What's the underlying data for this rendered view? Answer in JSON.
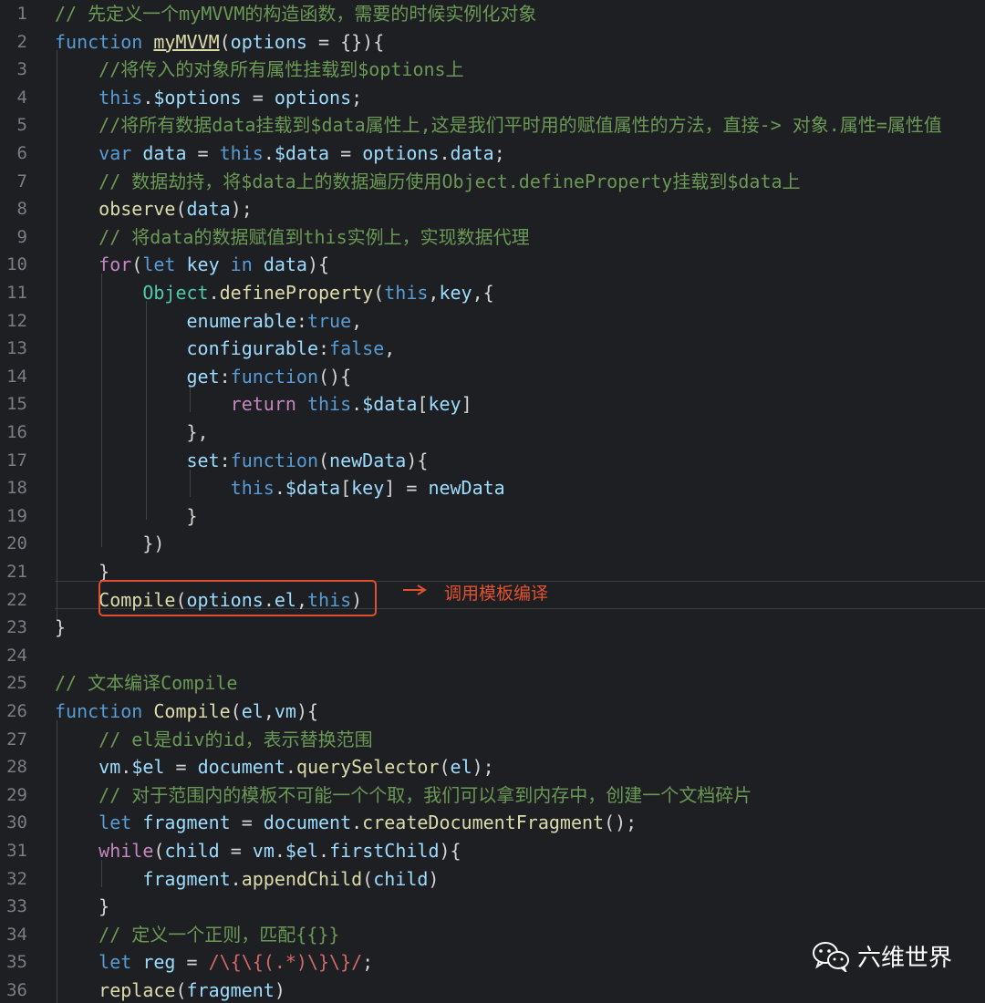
{
  "editor": {
    "lines": [
      {
        "num": "1",
        "tokens": [
          {
            "t": "// 先定义一个myMVVM的构造函数，需要的时候实例化对象",
            "c": "comment"
          }
        ]
      },
      {
        "num": "2",
        "tokens": [
          {
            "t": "function ",
            "c": "kw"
          },
          {
            "t": "myMVVM",
            "c": "fnname"
          },
          {
            "t": "(",
            "c": "plain"
          },
          {
            "t": "options",
            "c": "var"
          },
          {
            "t": " = {}){",
            "c": "plain"
          }
        ]
      },
      {
        "num": "3",
        "tokens": [
          {
            "t": "    //将传入的对象所有属性挂载到$options上",
            "c": "comment"
          }
        ]
      },
      {
        "num": "4",
        "tokens": [
          {
            "t": "    ",
            "c": "plain"
          },
          {
            "t": "this",
            "c": "kw"
          },
          {
            "t": ".",
            "c": "plain"
          },
          {
            "t": "$options",
            "c": "var"
          },
          {
            "t": " = ",
            "c": "plain"
          },
          {
            "t": "options",
            "c": "var"
          },
          {
            "t": ";",
            "c": "plain"
          }
        ]
      },
      {
        "num": "5",
        "tokens": [
          {
            "t": "    //将所有数据data挂载到$data属性上,这是我们平时用的赋值属性的方法，直接-> 对象.属性=属性值",
            "c": "comment"
          }
        ]
      },
      {
        "num": "6",
        "tokens": [
          {
            "t": "    ",
            "c": "plain"
          },
          {
            "t": "var ",
            "c": "kw"
          },
          {
            "t": "data",
            "c": "var"
          },
          {
            "t": " = ",
            "c": "plain"
          },
          {
            "t": "this",
            "c": "kw"
          },
          {
            "t": ".",
            "c": "plain"
          },
          {
            "t": "$data",
            "c": "var"
          },
          {
            "t": " = ",
            "c": "plain"
          },
          {
            "t": "options",
            "c": "var"
          },
          {
            "t": ".",
            "c": "plain"
          },
          {
            "t": "data",
            "c": "var"
          },
          {
            "t": ";",
            "c": "plain"
          }
        ]
      },
      {
        "num": "7",
        "tokens": [
          {
            "t": "    // 数据劫持，将$data上的数据遍历使用Object.defineProperty挂载到$data上",
            "c": "comment"
          }
        ]
      },
      {
        "num": "8",
        "tokens": [
          {
            "t": "    ",
            "c": "plain"
          },
          {
            "t": "observe",
            "c": "fn"
          },
          {
            "t": "(",
            "c": "plain"
          },
          {
            "t": "data",
            "c": "var"
          },
          {
            "t": ");",
            "c": "plain"
          }
        ]
      },
      {
        "num": "9",
        "tokens": [
          {
            "t": "    // 将data的数据赋值到this实例上，实现数据代理",
            "c": "comment"
          }
        ]
      },
      {
        "num": "10",
        "tokens": [
          {
            "t": "    ",
            "c": "plain"
          },
          {
            "t": "for",
            "c": "ctrl"
          },
          {
            "t": "(",
            "c": "plain"
          },
          {
            "t": "let ",
            "c": "kw"
          },
          {
            "t": "key",
            "c": "var"
          },
          {
            "t": " in ",
            "c": "kw"
          },
          {
            "t": "data",
            "c": "var"
          },
          {
            "t": "){",
            "c": "plain"
          }
        ]
      },
      {
        "num": "11",
        "tokens": [
          {
            "t": "        ",
            "c": "plain"
          },
          {
            "t": "Object",
            "c": "type"
          },
          {
            "t": ".",
            "c": "plain"
          },
          {
            "t": "defineProperty",
            "c": "fn"
          },
          {
            "t": "(",
            "c": "plain"
          },
          {
            "t": "this",
            "c": "kw"
          },
          {
            "t": ",",
            "c": "plain"
          },
          {
            "t": "key",
            "c": "var"
          },
          {
            "t": ",{",
            "c": "plain"
          }
        ]
      },
      {
        "num": "12",
        "tokens": [
          {
            "t": "            ",
            "c": "plain"
          },
          {
            "t": "enumerable",
            "c": "var"
          },
          {
            "t": ":",
            "c": "plain"
          },
          {
            "t": "true",
            "c": "kw"
          },
          {
            "t": ",",
            "c": "plain"
          }
        ]
      },
      {
        "num": "13",
        "tokens": [
          {
            "t": "            ",
            "c": "plain"
          },
          {
            "t": "configurable",
            "c": "var"
          },
          {
            "t": ":",
            "c": "plain"
          },
          {
            "t": "false",
            "c": "kw"
          },
          {
            "t": ",",
            "c": "plain"
          }
        ]
      },
      {
        "num": "14",
        "tokens": [
          {
            "t": "            ",
            "c": "plain"
          },
          {
            "t": "get",
            "c": "var"
          },
          {
            "t": ":",
            "c": "plain"
          },
          {
            "t": "function",
            "c": "kw"
          },
          {
            "t": "(){",
            "c": "plain"
          }
        ]
      },
      {
        "num": "15",
        "tokens": [
          {
            "t": "                ",
            "c": "plain"
          },
          {
            "t": "return ",
            "c": "ctrl"
          },
          {
            "t": "this",
            "c": "kw"
          },
          {
            "t": ".",
            "c": "plain"
          },
          {
            "t": "$data",
            "c": "var"
          },
          {
            "t": "[",
            "c": "plain"
          },
          {
            "t": "key",
            "c": "var"
          },
          {
            "t": "]",
            "c": "plain"
          }
        ]
      },
      {
        "num": "16",
        "tokens": [
          {
            "t": "            },",
            "c": "plain"
          }
        ]
      },
      {
        "num": "17",
        "tokens": [
          {
            "t": "            ",
            "c": "plain"
          },
          {
            "t": "set",
            "c": "var"
          },
          {
            "t": ":",
            "c": "plain"
          },
          {
            "t": "function",
            "c": "kw"
          },
          {
            "t": "(",
            "c": "plain"
          },
          {
            "t": "newData",
            "c": "var"
          },
          {
            "t": "){",
            "c": "plain"
          }
        ]
      },
      {
        "num": "18",
        "tokens": [
          {
            "t": "                ",
            "c": "plain"
          },
          {
            "t": "this",
            "c": "kw"
          },
          {
            "t": ".",
            "c": "plain"
          },
          {
            "t": "$data",
            "c": "var"
          },
          {
            "t": "[",
            "c": "plain"
          },
          {
            "t": "key",
            "c": "var"
          },
          {
            "t": "] = ",
            "c": "plain"
          },
          {
            "t": "newData",
            "c": "var"
          }
        ]
      },
      {
        "num": "19",
        "tokens": [
          {
            "t": "            }",
            "c": "plain"
          }
        ]
      },
      {
        "num": "20",
        "tokens": [
          {
            "t": "        })",
            "c": "plain"
          }
        ]
      },
      {
        "num": "21",
        "tokens": [
          {
            "t": "    }",
            "c": "plain"
          }
        ]
      },
      {
        "num": "22",
        "tokens": [
          {
            "t": "    ",
            "c": "plain"
          },
          {
            "t": "Compile",
            "c": "fn"
          },
          {
            "t": "(",
            "c": "plain"
          },
          {
            "t": "options",
            "c": "var"
          },
          {
            "t": ".",
            "c": "plain"
          },
          {
            "t": "el",
            "c": "var"
          },
          {
            "t": ",",
            "c": "plain"
          },
          {
            "t": "this",
            "c": "kw"
          },
          {
            "t": ")",
            "c": "plain"
          }
        ]
      },
      {
        "num": "23",
        "tokens": [
          {
            "t": "}",
            "c": "plain"
          }
        ]
      },
      {
        "num": "24",
        "tokens": []
      },
      {
        "num": "25",
        "tokens": [
          {
            "t": "// 文本编译Compile",
            "c": "comment"
          }
        ]
      },
      {
        "num": "26",
        "tokens": [
          {
            "t": "function ",
            "c": "kw"
          },
          {
            "t": "Compile",
            "c": "fn"
          },
          {
            "t": "(",
            "c": "plain"
          },
          {
            "t": "el",
            "c": "var"
          },
          {
            "t": ",",
            "c": "plain"
          },
          {
            "t": "vm",
            "c": "var"
          },
          {
            "t": "){",
            "c": "plain"
          }
        ]
      },
      {
        "num": "27",
        "tokens": [
          {
            "t": "    // el是div的id，表示替换范围",
            "c": "comment"
          }
        ]
      },
      {
        "num": "28",
        "tokens": [
          {
            "t": "    ",
            "c": "plain"
          },
          {
            "t": "vm",
            "c": "var"
          },
          {
            "t": ".",
            "c": "plain"
          },
          {
            "t": "$el",
            "c": "var"
          },
          {
            "t": " = ",
            "c": "plain"
          },
          {
            "t": "document",
            "c": "var"
          },
          {
            "t": ".",
            "c": "plain"
          },
          {
            "t": "querySelector",
            "c": "fn"
          },
          {
            "t": "(",
            "c": "plain"
          },
          {
            "t": "el",
            "c": "var"
          },
          {
            "t": ");",
            "c": "plain"
          }
        ]
      },
      {
        "num": "29",
        "tokens": [
          {
            "t": "    // 对于范围内的模板不可能一个个取，我们可以拿到内存中，创建一个文档碎片",
            "c": "comment"
          }
        ]
      },
      {
        "num": "30",
        "tokens": [
          {
            "t": "    ",
            "c": "plain"
          },
          {
            "t": "let ",
            "c": "kw"
          },
          {
            "t": "fragment",
            "c": "var"
          },
          {
            "t": " = ",
            "c": "plain"
          },
          {
            "t": "document",
            "c": "var"
          },
          {
            "t": ".",
            "c": "plain"
          },
          {
            "t": "createDocumentFragment",
            "c": "fn"
          },
          {
            "t": "();",
            "c": "plain"
          }
        ]
      },
      {
        "num": "31",
        "tokens": [
          {
            "t": "    ",
            "c": "plain"
          },
          {
            "t": "while",
            "c": "ctrl"
          },
          {
            "t": "(",
            "c": "plain"
          },
          {
            "t": "child",
            "c": "var"
          },
          {
            "t": " = ",
            "c": "plain"
          },
          {
            "t": "vm",
            "c": "var"
          },
          {
            "t": ".",
            "c": "plain"
          },
          {
            "t": "$el",
            "c": "var"
          },
          {
            "t": ".",
            "c": "plain"
          },
          {
            "t": "firstChild",
            "c": "var"
          },
          {
            "t": "){",
            "c": "plain"
          }
        ]
      },
      {
        "num": "32",
        "tokens": [
          {
            "t": "        ",
            "c": "plain"
          },
          {
            "t": "fragment",
            "c": "var"
          },
          {
            "t": ".",
            "c": "plain"
          },
          {
            "t": "appendChild",
            "c": "fn"
          },
          {
            "t": "(",
            "c": "plain"
          },
          {
            "t": "child",
            "c": "var"
          },
          {
            "t": ")",
            "c": "plain"
          }
        ]
      },
      {
        "num": "33",
        "tokens": [
          {
            "t": "    }",
            "c": "plain"
          }
        ]
      },
      {
        "num": "34",
        "tokens": [
          {
            "t": "    // 定义一个正则，匹配{{}}",
            "c": "comment"
          }
        ]
      },
      {
        "num": "35",
        "tokens": [
          {
            "t": "    ",
            "c": "plain"
          },
          {
            "t": "let ",
            "c": "kw"
          },
          {
            "t": "reg",
            "c": "var"
          },
          {
            "t": " = ",
            "c": "plain"
          },
          {
            "t": "/\\{\\{(.*)\\}\\}/",
            "c": "regex"
          },
          {
            "t": ";",
            "c": "plain"
          }
        ]
      },
      {
        "num": "36",
        "tokens": [
          {
            "t": "    ",
            "c": "plain"
          },
          {
            "t": "replace",
            "c": "fn"
          },
          {
            "t": "(",
            "c": "plain"
          },
          {
            "t": "fragment",
            "c": "var"
          },
          {
            "t": ")",
            "c": "plain"
          }
        ]
      }
    ],
    "current_line": "22"
  },
  "annotation": {
    "text": "调用模板编译"
  },
  "watermark": {
    "text": "六维世界",
    "icon": "wechat-icon"
  },
  "colors": {
    "background": "#1e1f22",
    "comment": "#6a9955",
    "keyword": "#569cd6",
    "function": "#dcdcaa",
    "variable": "#9cdcfe",
    "annotation": "#e0522f"
  }
}
